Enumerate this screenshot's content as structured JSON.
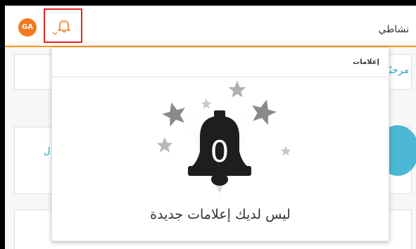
{
  "topbar": {
    "avatar_initials": "GA",
    "my_activity_label": "نشاطي",
    "accent_color": "#f7941d"
  },
  "background": {
    "welcome_fragment": "مرحبًا",
    "left_fragment": "ل"
  },
  "notifications": {
    "title": "إعلامات",
    "count": "0",
    "empty_message": "ليس لديك إعلامات جديدة",
    "bell_icon": "bell-icon",
    "highlight_color": "#e5201f"
  }
}
